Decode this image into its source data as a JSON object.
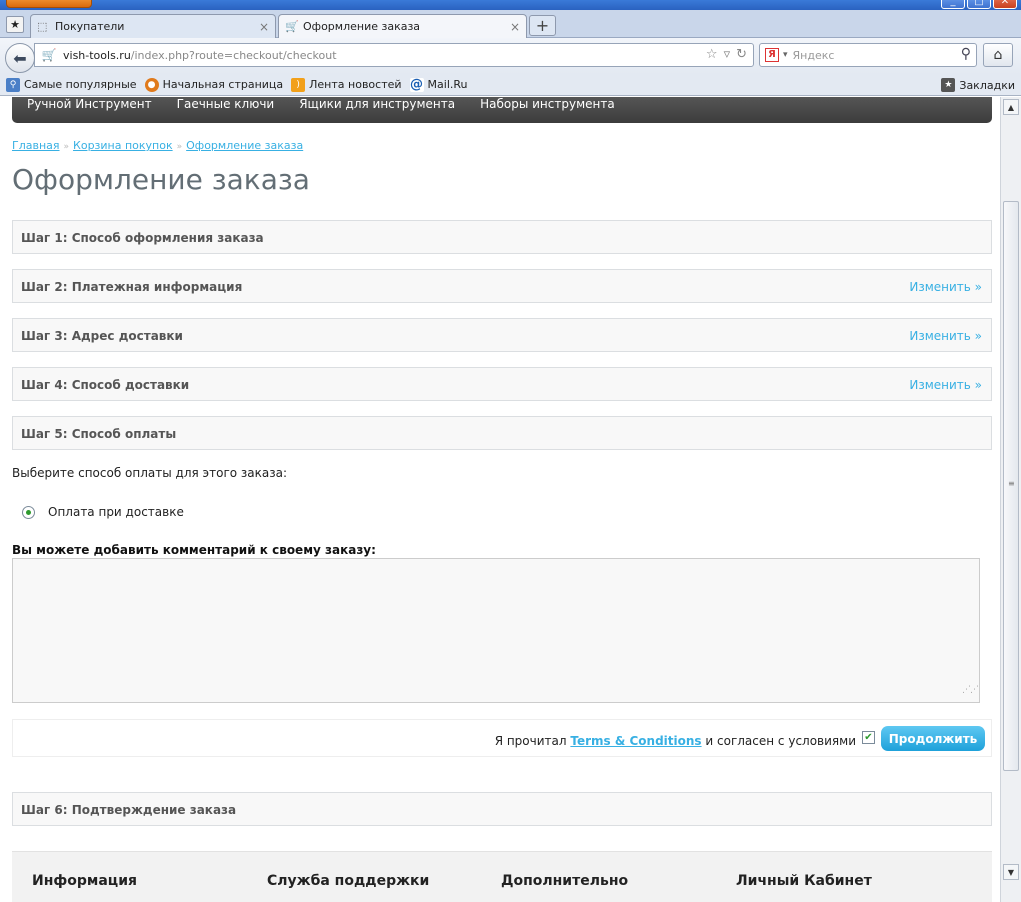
{
  "browser": {
    "tabs": [
      {
        "label": "Покупатели",
        "active": false
      },
      {
        "label": "Оформление заказа",
        "active": true
      }
    ],
    "new_tab_symbol": "+",
    "url_host": "vish-tools.ru",
    "url_path": "/index.php?route=checkout/checkout",
    "search_placeholder": "Яндекс",
    "bookmarks": [
      {
        "label": "Самые популярные",
        "icon": "popular-icon"
      },
      {
        "label": "Начальная страница",
        "icon": "firefox-icon"
      },
      {
        "label": "Лента новостей",
        "icon": "rss-icon"
      },
      {
        "label": "Mail.Ru",
        "icon": "at-icon"
      }
    ],
    "bookmarks_menu": "Закладки"
  },
  "menu": {
    "items": [
      "Ручной Инструмент",
      "Гаечные ключи",
      "Ящики для инструмента",
      "Наборы инструмента"
    ]
  },
  "breadcrumb": {
    "items": [
      "Главная",
      "Корзина покупок",
      "Оформление заказа"
    ],
    "separator": "»"
  },
  "page_title": "Оформление заказа",
  "steps": [
    {
      "title": "Шаг 1: Способ оформления заказа",
      "edit": ""
    },
    {
      "title": "Шаг 2: Платежная информация",
      "edit": "Изменить »"
    },
    {
      "title": "Шаг 3: Адрес доставки",
      "edit": "Изменить »"
    },
    {
      "title": "Шаг 4: Способ доставки",
      "edit": "Изменить »"
    },
    {
      "title": "Шаг 5: Способ оплаты",
      "edit": ""
    },
    {
      "title": "Шаг 6: Подтверждение заказа",
      "edit": ""
    }
  ],
  "payment": {
    "prompt": "Выберите способ оплаты для этого заказа:",
    "option": "Оплата при доставке",
    "option_selected": true,
    "comment_label": "Вы можете добавить комментарий к своему заказу:",
    "comment_value": ""
  },
  "agree": {
    "prefix": "Я прочитал",
    "link": "Terms & Conditions",
    "suffix": "и согласен с условиями",
    "checked": true,
    "button": "Продолжить"
  },
  "footer": {
    "columns": [
      "Информация",
      "Служба поддержки",
      "Дополнительно",
      "Личный Кабинет"
    ]
  },
  "colors": {
    "link": "#38b0e3",
    "button": "#1ea1da",
    "menu_bg": "#3c3c3c"
  }
}
